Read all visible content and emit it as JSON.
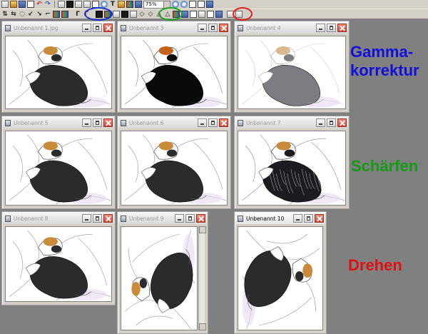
{
  "toolbar": {
    "zoom_value": "75%",
    "highlight_colors": {
      "flip_group": "#1a2fd0",
      "sharpen_group": "#20a020",
      "rotate_group": "#e02020"
    }
  },
  "windows": [
    {
      "title": "Unbenannt 1.jpg",
      "state": "inactive",
      "image": "dog-normal"
    },
    {
      "title": "Unbenannt 3",
      "state": "inactive",
      "image": "dog-dark"
    },
    {
      "title": "Unbenannt 4",
      "state": "inactive",
      "image": "dog-light"
    },
    {
      "title": "Unbenannt 5",
      "state": "inactive",
      "image": "dog-normal"
    },
    {
      "title": "Unbenannt 6",
      "state": "inactive",
      "image": "dog-normal"
    },
    {
      "title": "Unbenannt 7",
      "state": "inactive",
      "image": "dog-sharp"
    },
    {
      "title": "Unbenannt 8",
      "state": "inactive",
      "image": "dog-normal"
    },
    {
      "title": "Unbenannt 9",
      "state": "inactive",
      "image": "dog-rotated-left"
    },
    {
      "title": "Unbenannt 10",
      "state": "active",
      "image": "dog-rotated-right"
    }
  ],
  "labels": {
    "gamma": "Gamma-",
    "gamma_line2": "korrektur",
    "sharpen": "Schärfen",
    "rotate": "Drehen"
  },
  "colors": {
    "gamma": "#1010d8",
    "sharpen": "#149a14",
    "rotate": "#e01010",
    "desktop": "#808080"
  }
}
